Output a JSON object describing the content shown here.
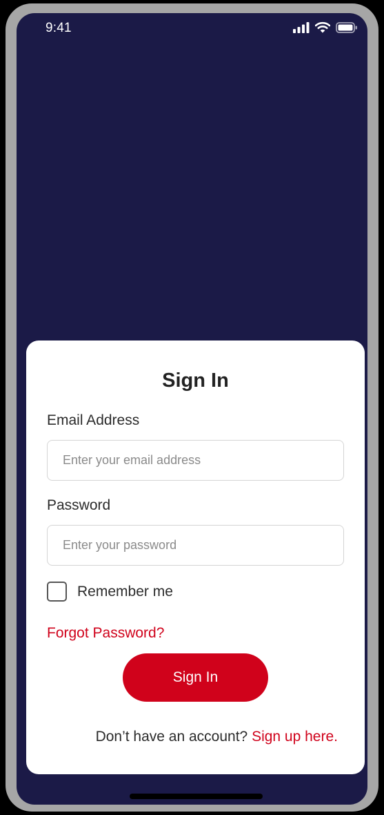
{
  "status_bar": {
    "time": "9:41",
    "icons": [
      "cellular-signal-icon",
      "wifi-icon",
      "battery-icon"
    ]
  },
  "colors": {
    "background": "#1b1a47",
    "card": "#ffffff",
    "accent": "#d0021b",
    "text": "#2b2b2b",
    "device_frame": "#a6a6a6"
  },
  "signin_form": {
    "title": "Sign In",
    "email": {
      "label": "Email Address",
      "placeholder": "Enter your email address",
      "value": ""
    },
    "password": {
      "label": "Password",
      "placeholder": "Enter your password",
      "value": ""
    },
    "remember_me": {
      "label": "Remember me",
      "checked": false
    },
    "forgot_password_label": "Forgot Password?",
    "submit_label": "Sign In",
    "signup_prompt": "Don’t have an account?",
    "signup_link_label": "Sign up here."
  }
}
